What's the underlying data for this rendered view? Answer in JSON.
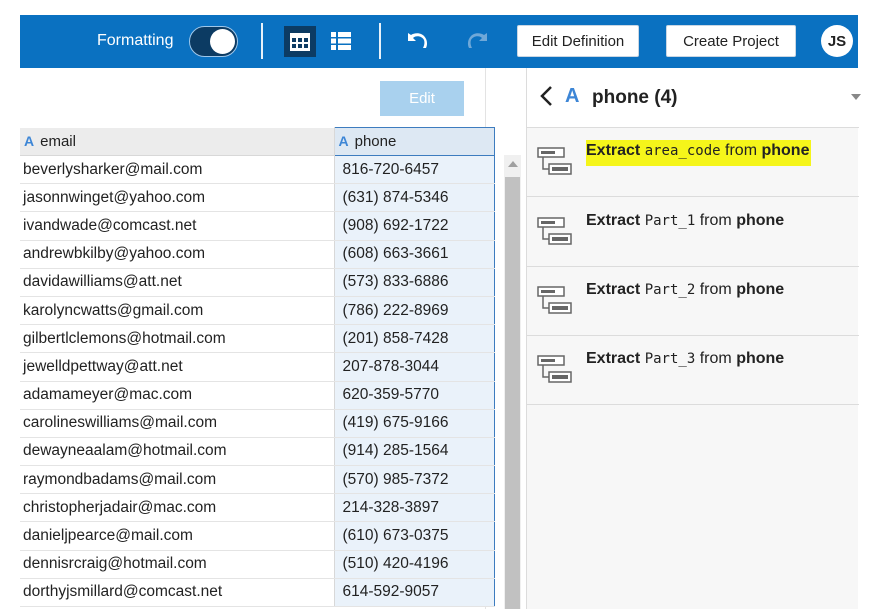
{
  "toolbar": {
    "formatting_label": "Formatting",
    "formatting_on": true,
    "edit_definition_label": "Edit Definition",
    "create_project_label": "Create Project",
    "avatar_initials": "JS"
  },
  "grid": {
    "edit_label": "Edit",
    "columns": [
      {
        "type_icon": "A",
        "name": "email"
      },
      {
        "type_icon": "A",
        "name": "phone"
      }
    ],
    "rows": [
      {
        "email": "beverlysharker@mail.com",
        "phone": "816-720-6457"
      },
      {
        "email": "jasonnwinget@yahoo.com",
        "phone": "(631) 874-5346"
      },
      {
        "email": "ivandwade@comcast.net",
        "phone": "(908) 692-1722"
      },
      {
        "email": "andrewbkilby@yahoo.com",
        "phone": "(608) 663-3661"
      },
      {
        "email": "davidawilliams@att.net",
        "phone": "(573) 833-6886"
      },
      {
        "email": "karolyncwatts@gmail.com",
        "phone": "(786) 222-8969"
      },
      {
        "email": "gilbertlclemons@hotmail.com",
        "phone": "(201) 858-7428"
      },
      {
        "email": "jewelldpettway@att.net",
        "phone": "207-878-3044"
      },
      {
        "email": "adamameyer@mac.com",
        "phone": "620-359-5770"
      },
      {
        "email": "carolineswilliams@mail.com",
        "phone": "(419) 675-9166"
      },
      {
        "email": "dewayneaalam@hotmail.com",
        "phone": "(914) 285-1564"
      },
      {
        "email": "raymondbadams@mail.com",
        "phone": "(570) 985-7372"
      },
      {
        "email": "christopherjadair@mac.com",
        "phone": "214-328-3897"
      },
      {
        "email": "danieljpearce@mail.com",
        "phone": "(610) 673-0375"
      },
      {
        "email": "dennisrcraig@hotmail.com",
        "phone": "(510) 420-4196"
      },
      {
        "email": "dorthyjsmillard@comcast.net",
        "phone": "614-592-9057"
      }
    ]
  },
  "panel": {
    "type_icon": "A",
    "title": "phone (4)",
    "suggestions": [
      {
        "verb": "Extract",
        "part": "area_code",
        "from_word": "from",
        "column": "phone",
        "highlighted": true
      },
      {
        "verb": "Extract",
        "part": "Part_1",
        "from_word": "from",
        "column": "phone",
        "highlighted": false
      },
      {
        "verb": "Extract",
        "part": "Part_2",
        "from_word": "from",
        "column": "phone",
        "highlighted": false
      },
      {
        "verb": "Extract",
        "part": "Part_3",
        "from_word": "from",
        "column": "phone",
        "highlighted": false
      }
    ],
    "highlight_color": "#f5f51a"
  },
  "colors": {
    "toolbar_bg": "#0a71c1",
    "active_icon_bg": "#0c3b63",
    "edit_button_bg": "#a9d1ee",
    "type_icon_color": "#3d86d6"
  },
  "icons": [
    "grid-view-icon",
    "list-view-icon",
    "undo-icon",
    "redo-icon",
    "back-chevron-icon",
    "suggestion-transform-icon"
  ]
}
